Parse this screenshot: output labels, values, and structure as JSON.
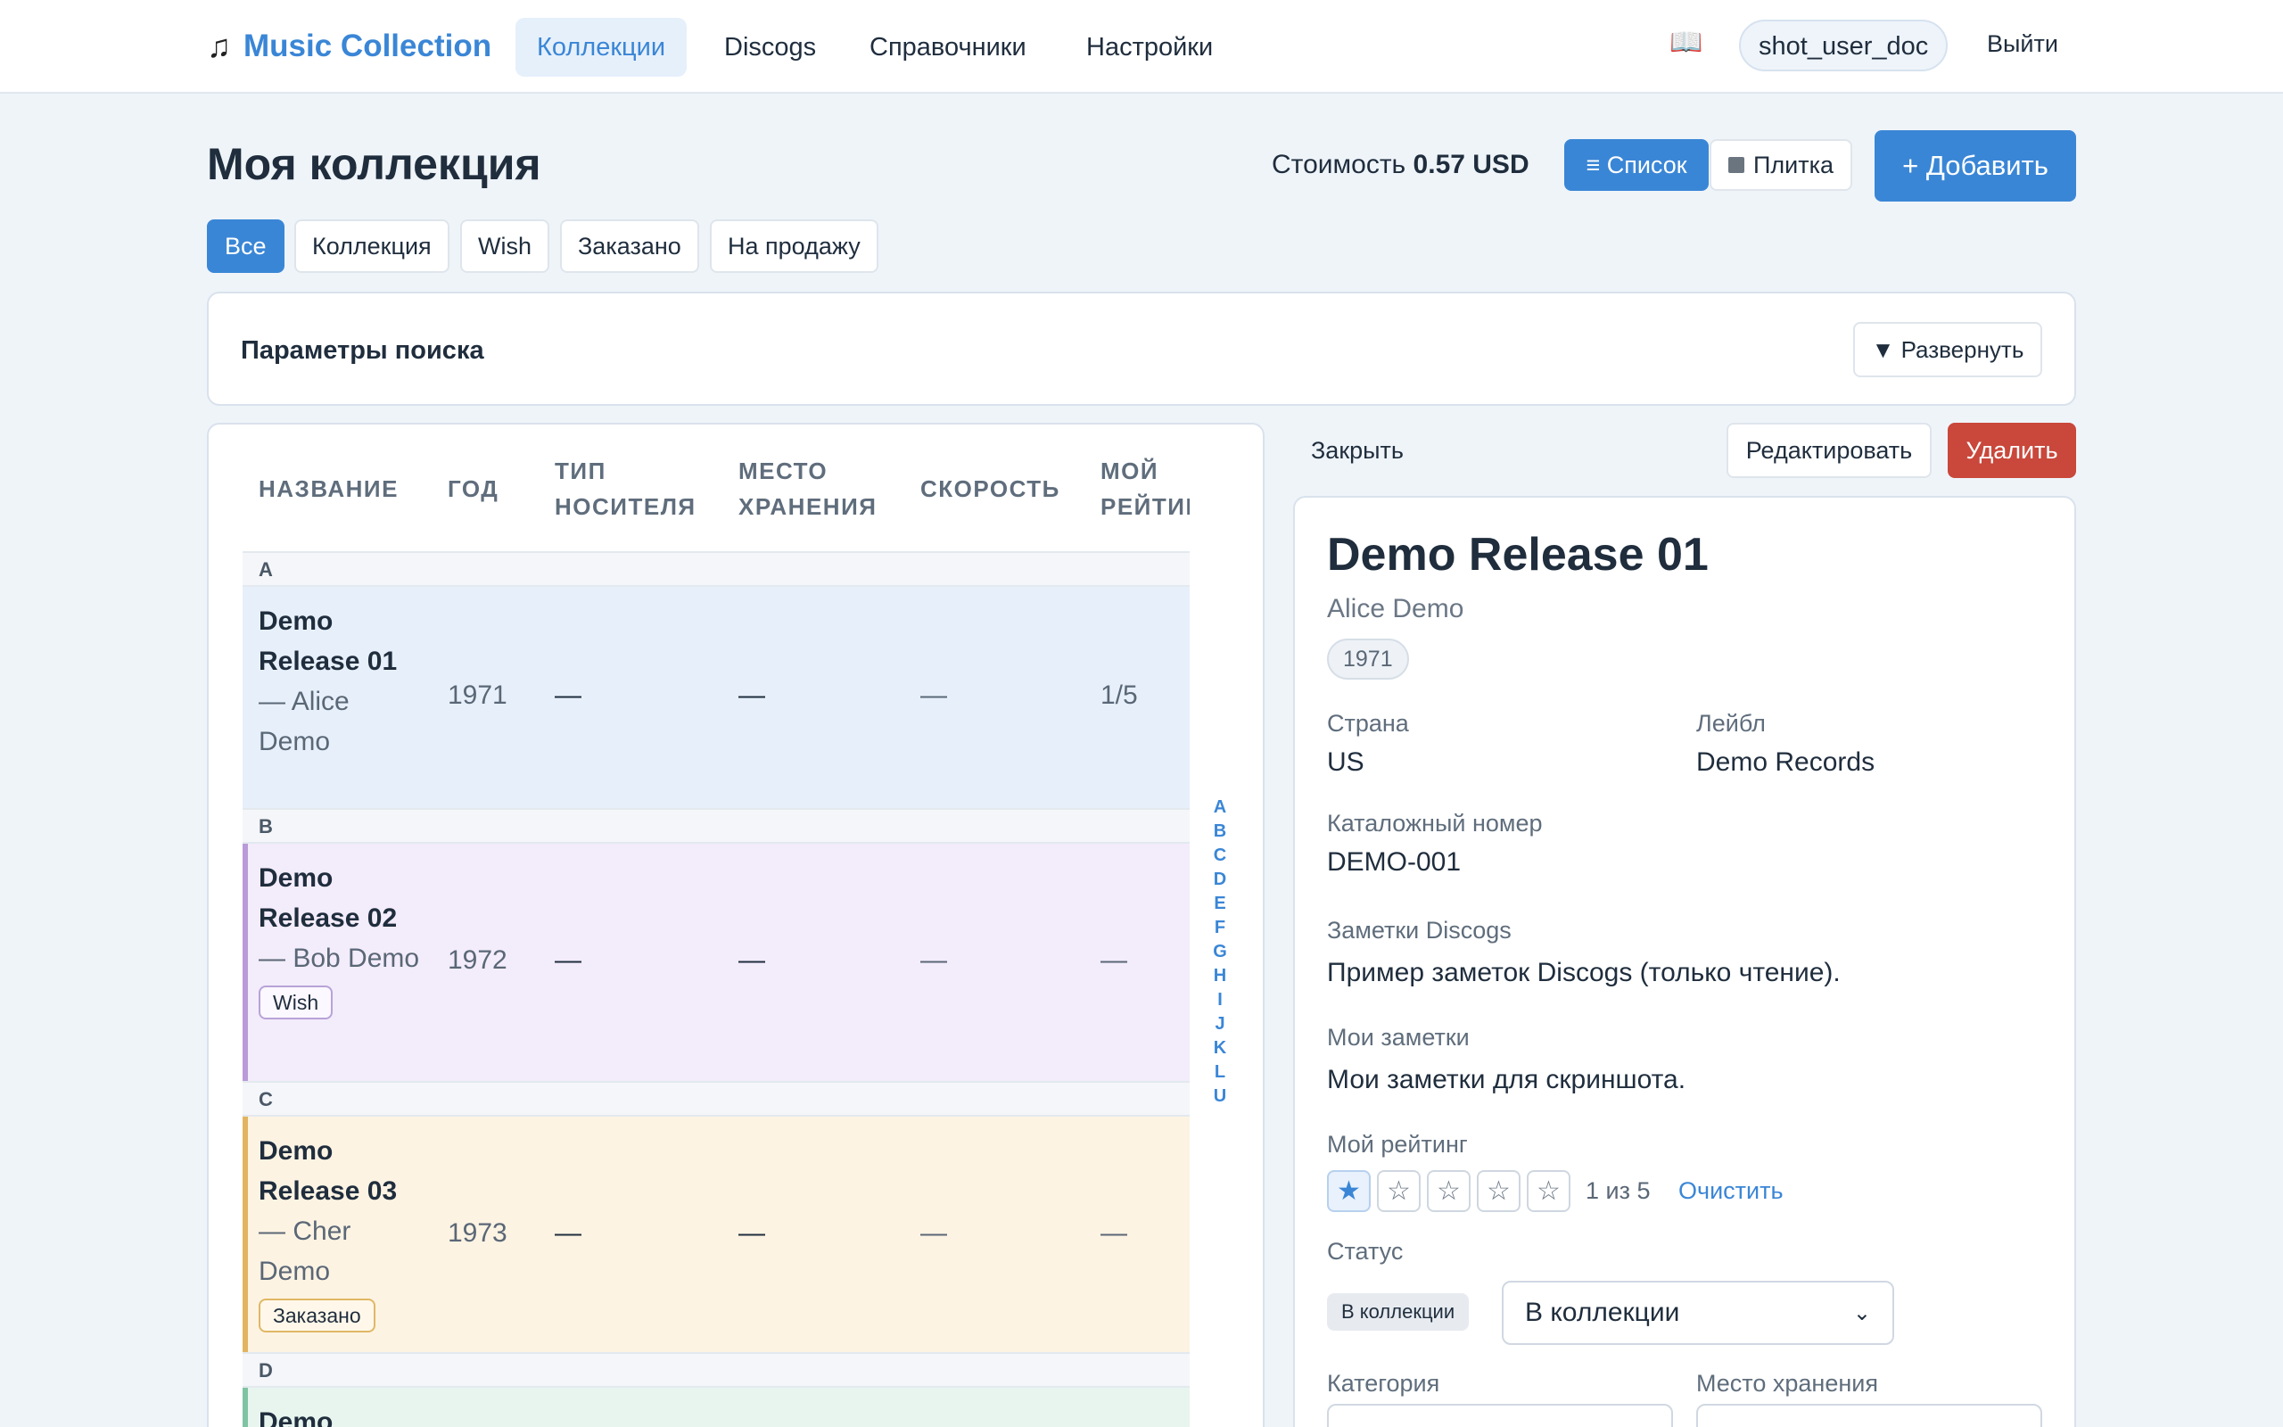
{
  "nav": {
    "brand_icon": "♫",
    "brand": "Music Collection",
    "items": [
      "Коллекции",
      "Discogs",
      "Справочники",
      "Настройки"
    ],
    "help_icon": "📖",
    "user": "shot_user_doc",
    "logout": "Выйти"
  },
  "header": {
    "title": "Моя коллекция",
    "cost_label": "Стоимость",
    "cost_value": "0.57 USD",
    "view_list": "≡ Список",
    "view_tile": "Плитка",
    "add": "+ Добавить"
  },
  "filters": [
    "Все",
    "Коллекция",
    "Wish",
    "Заказано",
    "На продажу"
  ],
  "search": {
    "title": "Параметры поиска",
    "expand": "▼ Развернуть"
  },
  "table": {
    "columns": [
      "НАЗВАНИЕ",
      "ГОД",
      "ТИП\nНОСИТЕЛЯ",
      "МЕСТО\nХРАНЕНИЯ",
      "СКОРОСТЬ",
      "МОЙ\nРЕЙТИНГ"
    ],
    "groups": [
      {
        "letter": "A",
        "row": {
          "title": "Demo Release 01",
          "artist": "Alice Demo",
          "year": "1971",
          "media": "—",
          "storage": "—",
          "speed": "—",
          "rating": "1/5",
          "badge": "",
          "color": "#e7f0fa"
        }
      },
      {
        "letter": "B",
        "row": {
          "title": "Demo Release 02",
          "artist": "Bob Demo",
          "year": "1972",
          "media": "—",
          "storage": "—",
          "speed": "—",
          "rating": "—",
          "badge": "Wish",
          "color": "#f3ecfb",
          "bar": "#b89bd8"
        }
      },
      {
        "letter": "C",
        "row": {
          "title": "Demo Release 03",
          "artist": "Cher Demo",
          "year": "1973",
          "media": "—",
          "storage": "—",
          "speed": "—",
          "rating": "—",
          "badge": "Заказано",
          "color": "#fdf3e3",
          "bar": "#e2b460"
        }
      },
      {
        "letter": "D",
        "row": {
          "title": "Demo Release",
          "artist": "",
          "year": "",
          "media": "",
          "storage": "",
          "speed": "",
          "rating": "",
          "badge": "",
          "color": "#e8f5ef",
          "bar": "#7ec4a2"
        }
      }
    ],
    "alphabet": [
      "A",
      "B",
      "C",
      "D",
      "E",
      "F",
      "G",
      "H",
      "I",
      "J",
      "K",
      "L",
      "U"
    ]
  },
  "detail": {
    "close": "Закрыть",
    "edit": "Редактировать",
    "delete": "Удалить",
    "title": "Demo Release 01",
    "artist": "Alice Demo",
    "year": "1971",
    "country_label": "Страна",
    "country": "US",
    "label_label": "Лейбл",
    "label": "Demo Records",
    "catno_label": "Каталожный номер",
    "catno": "DEMO-001",
    "discogs_notes_label": "Заметки Discogs",
    "discogs_notes": "Пример заметок Discogs (только чтение).",
    "my_notes_label": "Мои заметки",
    "my_notes": "Мои заметки для скриншота.",
    "rating_label": "Мой рейтинг",
    "rating_value": 1,
    "rating_max": 5,
    "rating_text": "1 из 5",
    "rating_clear": "Очистить",
    "status_label": "Статус",
    "status_badge": "В коллекции",
    "status_selected": "В коллекции",
    "category_label": "Категория",
    "storage_label": "Место хранения"
  }
}
